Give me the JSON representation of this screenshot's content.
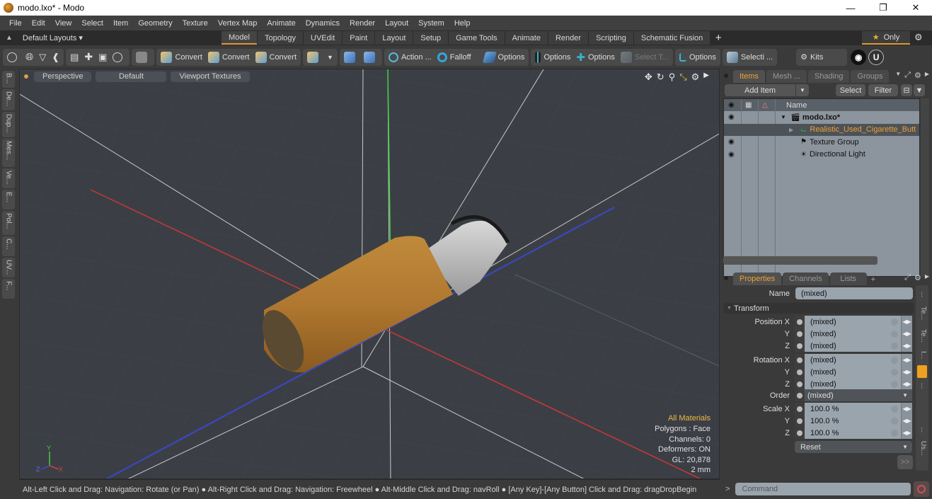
{
  "window": {
    "title": "modo.lxo* - Modo",
    "controls": [
      "minimize",
      "restore",
      "close"
    ]
  },
  "menubar": [
    "File",
    "Edit",
    "View",
    "Select",
    "Item",
    "Geometry",
    "Texture",
    "Vertex Map",
    "Animate",
    "Dynamics",
    "Render",
    "Layout",
    "System",
    "Help"
  ],
  "layoutbar": {
    "layouts_label": "Default Layouts ▾",
    "tabs": [
      "Model",
      "Topology",
      "UVEdit",
      "Paint",
      "Layout",
      "Setup",
      "Game Tools",
      "Animate",
      "Render",
      "Scripting",
      "Schematic Fusion"
    ],
    "active_tab": "Model",
    "only_label": "Only"
  },
  "toolbar": {
    "convert_1": "Convert",
    "convert_2": "Convert",
    "convert_3": "Convert",
    "action": "Action ...",
    "falloff": "Falloff",
    "options_1": "Options",
    "options_2": "Options",
    "options_3": "Options",
    "select_t": "Select T...",
    "options_4": "Options",
    "selecti": "Selecti ...",
    "kits": "Kits"
  },
  "left_strip": [
    "B...",
    "De...",
    "Dup...",
    "Mes...",
    "Ve...",
    "E...",
    "Pol...",
    "C...",
    "UV...",
    "F..."
  ],
  "viewport": {
    "view_mode": "Perspective",
    "shading": "Default",
    "textures": "Viewport Textures",
    "info": {
      "materials": "All Materials",
      "polygons": "Polygons : Face",
      "channels": "Channels: 0",
      "deformers": "Deformers: ON",
      "gl": "GL: 20,878",
      "unit": "2 mm"
    },
    "axis_labels": {
      "y": "Y",
      "z": "Z",
      "x": "X"
    }
  },
  "statusbar": {
    "hint": "Alt-Left Click and Drag: Navigation: Rotate (or Pan) ● Alt-Right Click and Drag: Navigation: Freewheel ● Alt-Middle Click and Drag: navRoll ● [Any Key]-[Any Button] Click and Drag: dragDropBegin"
  },
  "items_panel": {
    "tabs": [
      "Items",
      "Mesh ...",
      "Shading",
      "Groups"
    ],
    "active_tab": "Items",
    "add_item": "Add Item",
    "select": "Select",
    "filter": "Filter",
    "column_name": "Name",
    "rows": [
      {
        "name": "modo.lxo*",
        "visible": true,
        "selected": false,
        "type": "scene"
      },
      {
        "name": "Realistic_Used_Cigarette_Butt",
        "visible": false,
        "selected": true,
        "type": "mesh"
      },
      {
        "name": "Texture Group",
        "visible": true,
        "selected": false,
        "type": "texture"
      },
      {
        "name": "Directional Light",
        "visible": true,
        "selected": false,
        "type": "light"
      }
    ]
  },
  "properties_panel": {
    "tabs": [
      "Properties",
      "Channels",
      "Lists"
    ],
    "active_tab": "Properties",
    "name_label": "Name",
    "name_value": "(mixed)",
    "section": "Transform",
    "position": {
      "label": "Position X",
      "x": "(mixed)",
      "y": "(mixed)",
      "z": "(mixed)"
    },
    "rotation": {
      "label": "Rotation X",
      "x": "(mixed)",
      "y": "(mixed)",
      "z": "(mixed)"
    },
    "order": {
      "label": "Order",
      "value": "(mixed)"
    },
    "scale": {
      "label": "Scale X",
      "x": "100.0 %",
      "y": "100.0 %",
      "z": "100.0 %"
    },
    "y_label": "Y",
    "z_label": "Z",
    "reset": "Reset",
    "more": ">>"
  },
  "side_tabs": [
    "...",
    "Te...",
    "Te...",
    "I...",
    "...",
    "...",
    "Us..."
  ],
  "command": {
    "prompt": ">",
    "placeholder": "Command"
  },
  "colors": {
    "accent": "#f0a030",
    "axis_x": "#c03030",
    "axis_y": "#30c030",
    "axis_z": "#3040c0"
  }
}
